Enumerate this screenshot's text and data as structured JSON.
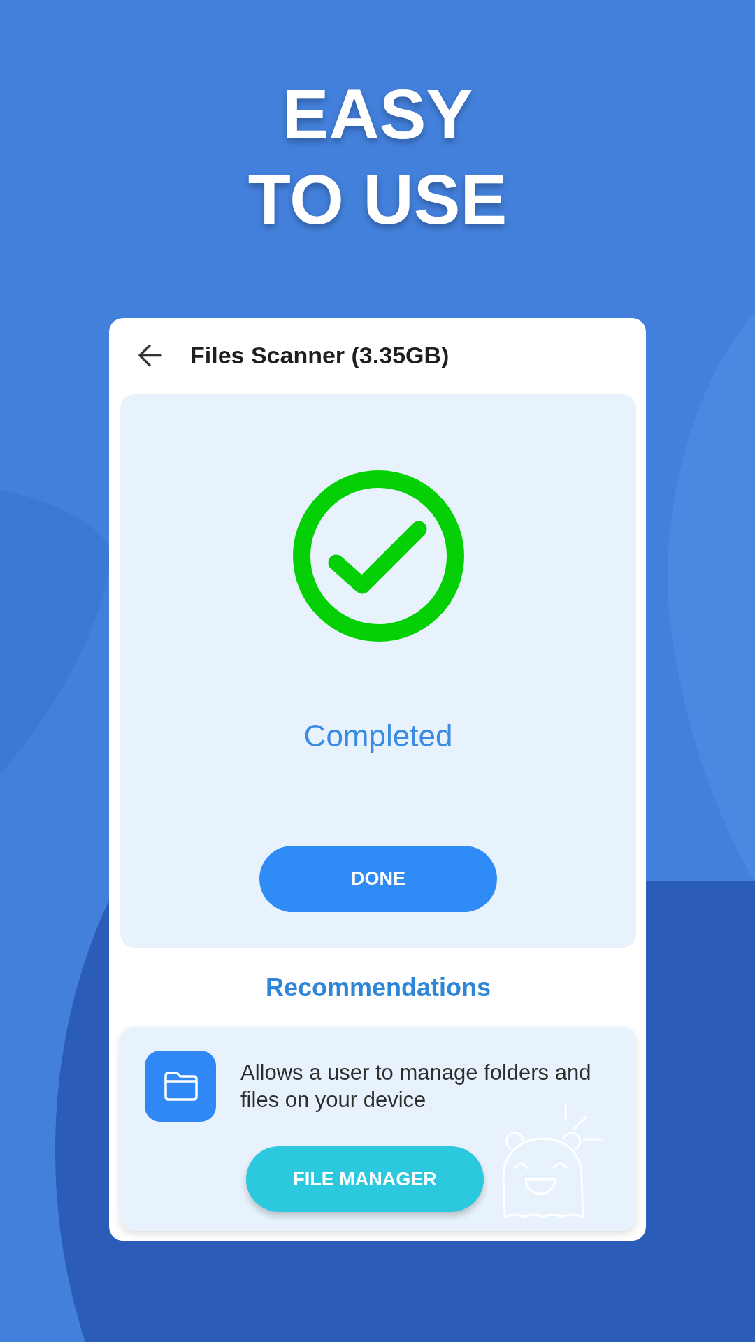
{
  "headline": "EASY TO USE",
  "screen": {
    "title": "Files Scanner (3.35GB)",
    "status": "Completed",
    "done_button": "DONE"
  },
  "recommendations": {
    "title": "Recommendations",
    "items": [
      {
        "description": "Allows a user to manage folders and files on your device",
        "button": "FILE MANAGER"
      }
    ]
  }
}
